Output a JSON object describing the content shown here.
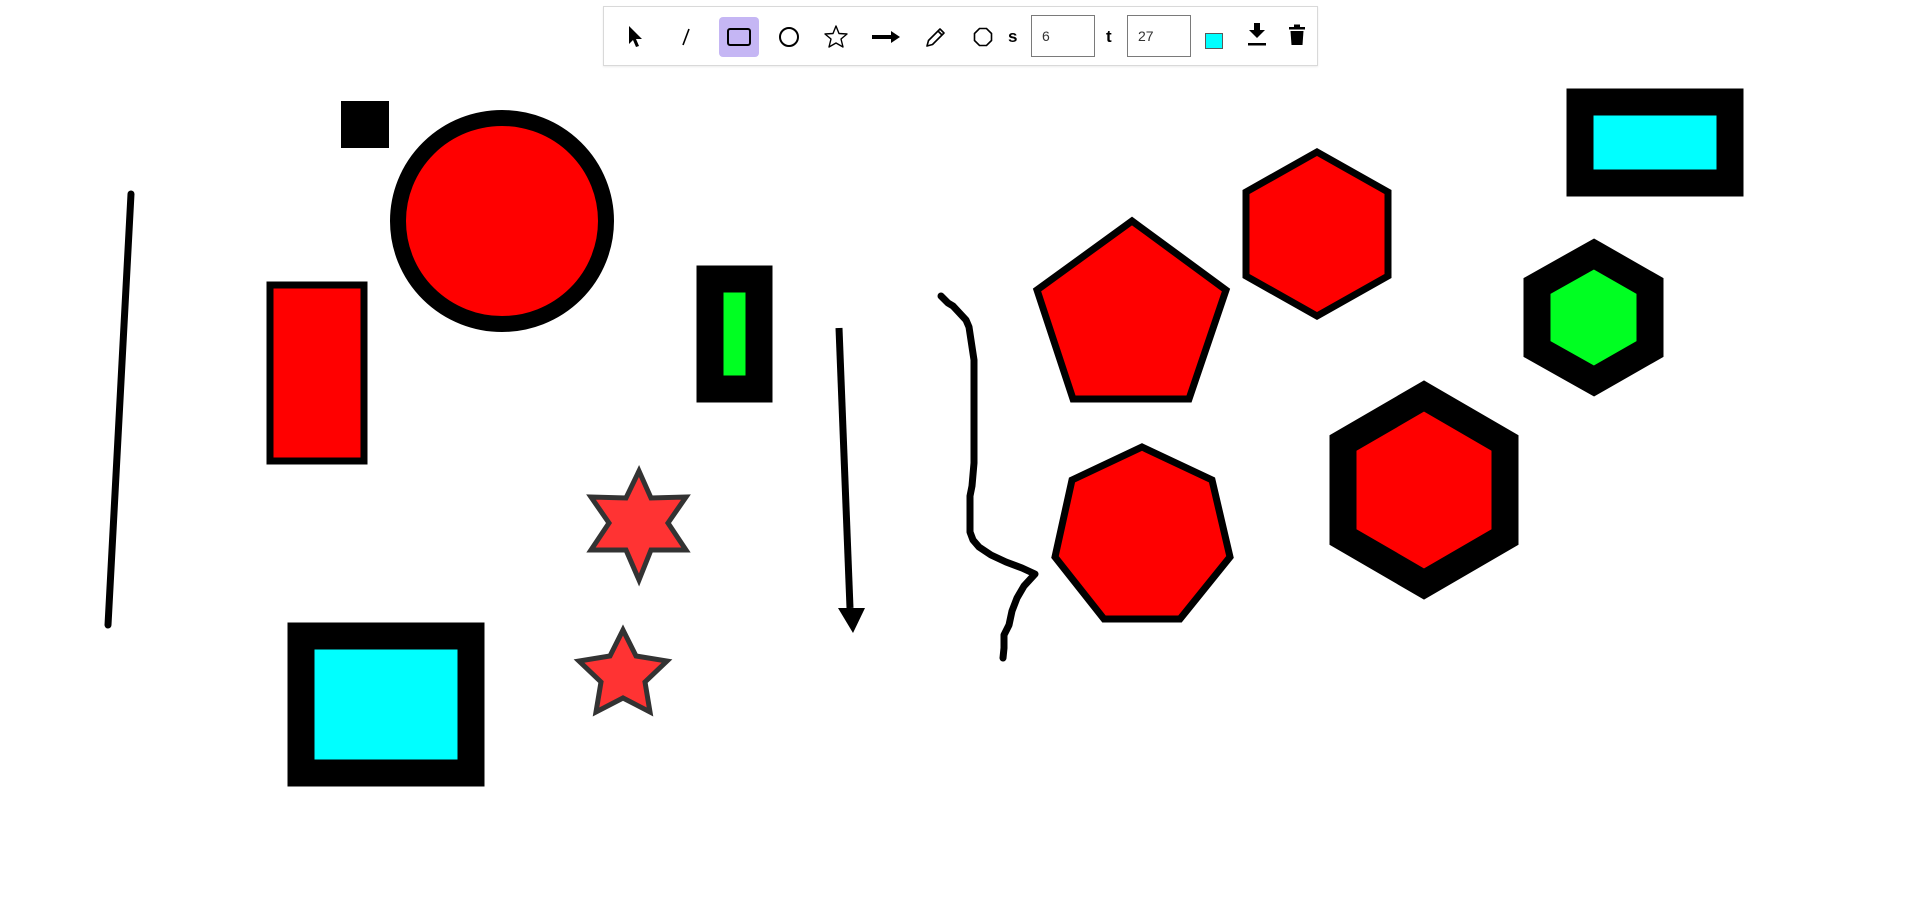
{
  "toolbar": {
    "tools": [
      {
        "id": "select",
        "icon": "cursor-icon",
        "active": false
      },
      {
        "id": "line",
        "icon": "line-icon",
        "active": false
      },
      {
        "id": "rectangle",
        "icon": "rectangle-icon",
        "active": true
      },
      {
        "id": "circle",
        "icon": "circle-icon",
        "active": false
      },
      {
        "id": "star",
        "icon": "star-icon",
        "active": false
      },
      {
        "id": "arrow",
        "icon": "arrow-icon",
        "active": false
      },
      {
        "id": "pencil",
        "icon": "pencil-icon",
        "active": false
      },
      {
        "id": "polygon",
        "icon": "octagon-icon",
        "active": false
      }
    ],
    "sides_label": "s",
    "sides_value": "6",
    "thickness_label": "t",
    "thickness_value": "27",
    "fill_color": "#00ffff",
    "download_icon": "download-icon",
    "delete_icon": "trash-icon"
  },
  "colors": {
    "stroke": "#000000",
    "red": "#ff0000",
    "green": "#00ff22",
    "cyan": "#00ffff",
    "star_fill": "#ff3333",
    "star_stroke": "#333333",
    "active_tool_bg": "#c5b6f4"
  }
}
